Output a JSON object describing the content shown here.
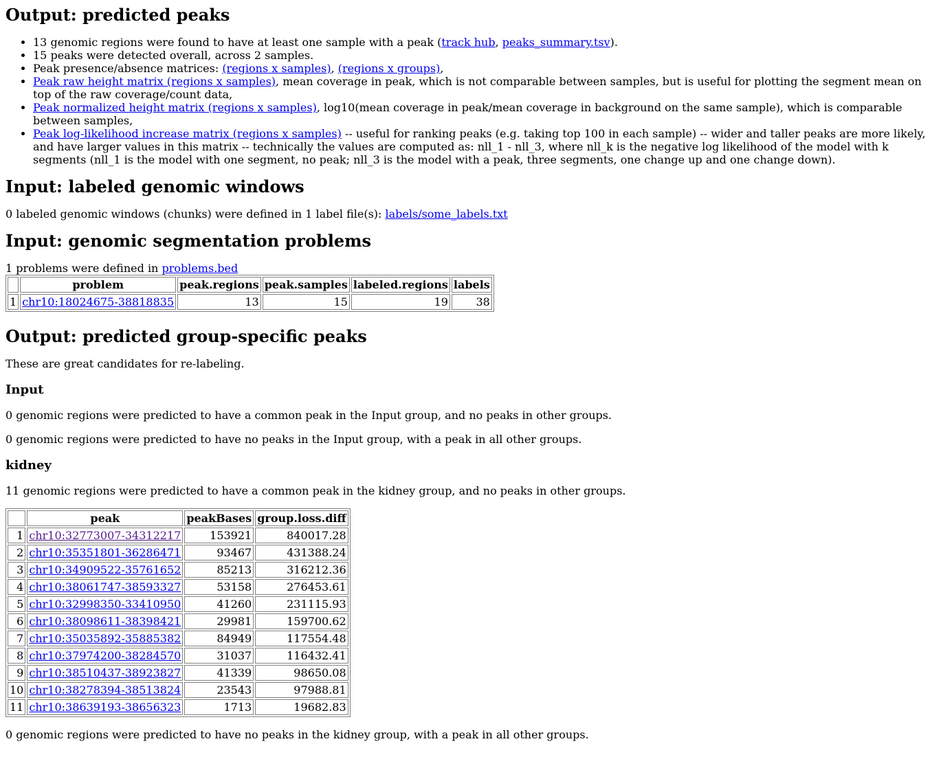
{
  "section_peaks": {
    "heading": "Output: predicted peaks",
    "item1_pre": "13 genomic regions were found to have at least one sample with a peak (",
    "item1_link1": "track hub",
    "item1_sep": ", ",
    "item1_link2": "peaks_summary.tsv",
    "item1_post": ").",
    "item2": "15 peaks were detected overall, across 2 samples.",
    "item3_pre": "Peak presence/absence matrices: ",
    "item3_link1": "(regions x samples)",
    "item3_sep": ", ",
    "item3_link2": "(regions x groups)",
    "item3_post": ",",
    "item4_link": "Peak raw height matrix (regions x samples)",
    "item4_post": ", mean coverage in peak, which is not comparable between samples, but is useful for plotting the segment mean on top of the raw coverage/count data,",
    "item5_link": "Peak normalized height matrix (regions x samples)",
    "item5_post": ", log10(mean coverage in peak/mean coverage in background on the same sample), which is comparable between samples,",
    "item6_link": "Peak log-likelihood increase matrix (regions x samples)",
    "item6_post": " -- useful for ranking peaks (e.g. taking top 100 in each sample) -- wider and taller peaks are more likely, and have larger values in this matrix -- technically the values are computed as: nll_1 - nll_3, where nll_k is the negative log likelihood of the model with k segments (nll_1 is the model with one segment, no peak; nll_3 is the model with a peak, three segments, one change up and one change down)."
  },
  "section_labels": {
    "heading": "Input: labeled genomic windows",
    "text_pre": "0 labeled genomic windows (chunks) were defined in 1 label file(s): ",
    "link": "labels/some_labels.txt"
  },
  "section_problems": {
    "heading": "Input: genomic segmentation problems",
    "text_pre": "1 problems were defined in ",
    "link": "problems.bed",
    "columns": [
      "",
      "problem",
      "peak.regions",
      "peak.samples",
      "labeled.regions",
      "labels"
    ],
    "rows": [
      {
        "n": "1",
        "problem": "chr10:18024675-38818835",
        "peak_regions": "13",
        "peak_samples": "15",
        "labeled_regions": "19",
        "labels": "38"
      }
    ]
  },
  "section_groups": {
    "heading": "Output: predicted group-specific peaks",
    "intro": "These are great candidates for re-labeling.",
    "input_group": {
      "heading": "Input",
      "text1": "0 genomic regions were predicted to have a common peak in the Input group, and no peaks in other groups.",
      "text2": "0 genomic regions were predicted to have no peaks in the Input group, with a peak in all other groups."
    },
    "kidney_group": {
      "heading": "kidney",
      "text1": "11 genomic regions were predicted to have a common peak in the kidney group, and no peaks in other groups.",
      "columns": [
        "",
        "peak",
        "peakBases",
        "group.loss.diff"
      ],
      "rows": [
        {
          "n": "1",
          "peak": "chr10:32773007-34312217",
          "bases": "153921",
          "diff": "840017.28"
        },
        {
          "n": "2",
          "peak": "chr10:35351801-36286471",
          "bases": "93467",
          "diff": "431388.24"
        },
        {
          "n": "3",
          "peak": "chr10:34909522-35761652",
          "bases": "85213",
          "diff": "316212.36"
        },
        {
          "n": "4",
          "peak": "chr10:38061747-38593327",
          "bases": "53158",
          "diff": "276453.61"
        },
        {
          "n": "5",
          "peak": "chr10:32998350-33410950",
          "bases": "41260",
          "diff": "231115.93"
        },
        {
          "n": "6",
          "peak": "chr10:38098611-38398421",
          "bases": "29981",
          "diff": "159700.62"
        },
        {
          "n": "7",
          "peak": "chr10:35035892-35885382",
          "bases": "84949",
          "diff": "117554.48"
        },
        {
          "n": "8",
          "peak": "chr10:37974200-38284570",
          "bases": "31037",
          "diff": "116432.41"
        },
        {
          "n": "9",
          "peak": "chr10:38510437-38923827",
          "bases": "41339",
          "diff": "98650.08"
        },
        {
          "n": "10",
          "peak": "chr10:38278394-38513824",
          "bases": "23543",
          "diff": "97988.81"
        },
        {
          "n": "11",
          "peak": "chr10:38639193-38656323",
          "bases": "1713",
          "diff": "19682.83"
        }
      ],
      "text2": "0 genomic regions were predicted to have no peaks in the kidney group, with a peak in all other groups."
    }
  }
}
